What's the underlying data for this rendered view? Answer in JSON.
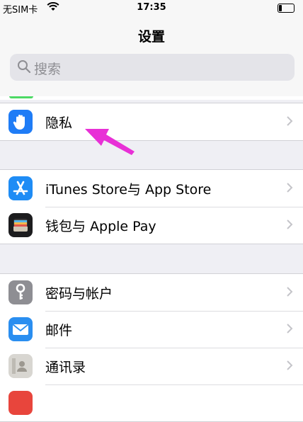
{
  "status": {
    "carrier": "无SIM卡",
    "time": "17:35"
  },
  "nav": {
    "title": "设置"
  },
  "search": {
    "placeholder": "搜索"
  },
  "rows": {
    "privacy": "隐私",
    "itunes": "iTunes Store与 App Store",
    "wallet": "钱包与 Apple Pay",
    "passwords": "密码与帐户",
    "mail": "邮件",
    "contacts": "通讯录"
  },
  "colors": {
    "accent_arrow": "#e830d6",
    "privacy_icon": "#1f7cf6",
    "mail_icon": "#2a8ef0",
    "appstore_icon": "#1e8cf5"
  },
  "icons": {
    "privacy": "hand-icon",
    "itunes": "app-store-icon",
    "wallet": "wallet-icon",
    "passwords": "key-icon",
    "mail": "mail-icon",
    "contacts": "contacts-icon"
  }
}
